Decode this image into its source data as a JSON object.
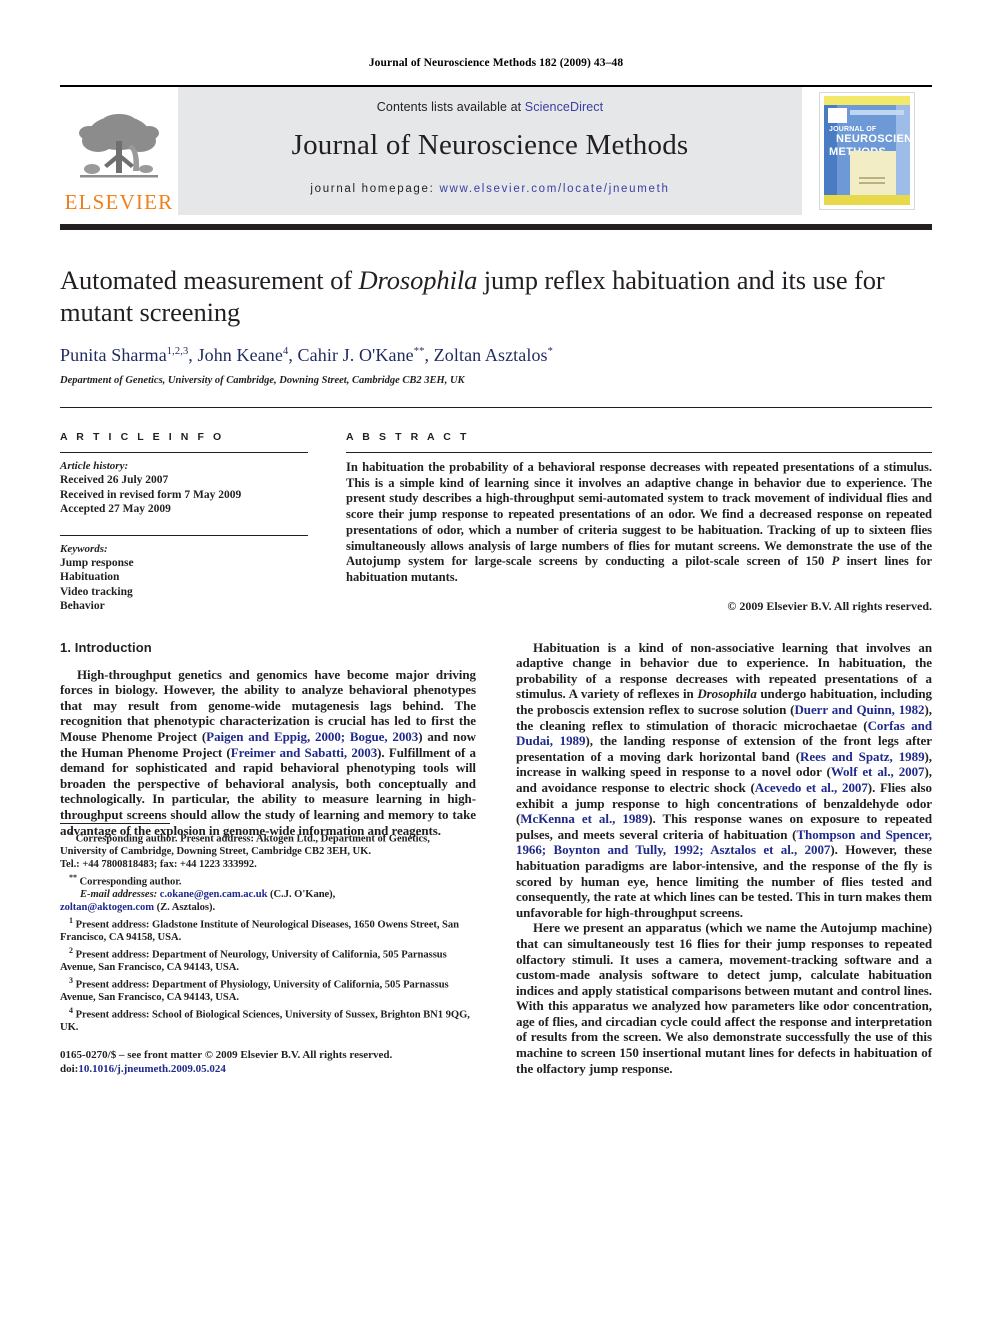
{
  "running_head": "Journal of Neuroscience Methods 182 (2009) 43–48",
  "masthead": {
    "publisher_logo_text": "ELSEVIER",
    "contents_prefix": "Contents lists available at ",
    "contents_link": "ScienceDirect",
    "journal_title": "Journal of Neuroscience Methods",
    "homepage_prefix": "journal homepage:",
    "homepage_url": "www.elsevier.com/locate/jneumeth",
    "cover": {
      "line1": "JOURNAL OF",
      "line2": "NEUROSCIENCE",
      "line3": "METHODS"
    }
  },
  "article": {
    "title_part1": "Automated measurement of ",
    "title_species": "Drosophila",
    "title_part2": " jump reflex habituation and its use for mutant screening",
    "authors": "Punita Sharma, John Keane, Cahir J. O'Kane, Zoltan Asztalos",
    "author_list": [
      {
        "name": "Punita Sharma",
        "marks": "1,2,3"
      },
      {
        "name": "John Keane",
        "marks": "4"
      },
      {
        "name": "Cahir J. O'Kane",
        "marks": "**"
      },
      {
        "name": "Zoltan Asztalos",
        "marks": "*"
      }
    ],
    "affiliation": "Department of Genetics, University of Cambridge, Downing Street, Cambridge CB2 3EH, UK"
  },
  "article_info": {
    "heading": "A R T I C L E   I N F O",
    "history_label": "Article history:",
    "history": [
      "Received 26 July 2007",
      "Received in revised form 7 May 2009",
      "Accepted 27 May 2009"
    ],
    "keywords_label": "Keywords:",
    "keywords": [
      "Jump response",
      "Habituation",
      "Video tracking",
      "Behavior"
    ]
  },
  "abstract": {
    "heading": "A B S T R A C T",
    "text_1": "In habituation the probability of a behavioral response decreases with repeated presentations of a stimulus. This is a simple kind of learning since it involves an adaptive change in behavior due to experience. The present study describes a high-throughput semi-automated system to track movement of individual flies and score their jump response to repeated presentations of an odor. We find a decreased response on repeated presentations of odor, which a number of criteria suggest to be habituation. Tracking of up to sixteen flies simultaneously allows analysis of large numbers of flies for mutant screens. We demonstrate the use of the Autojump system for large-scale screens by conducting a pilot-scale screen of 150 ",
    "text_italic": "P",
    "text_2": " insert lines for habituation mutants.",
    "copyright": "© 2009 Elsevier B.V. All rights reserved."
  },
  "introduction": {
    "section_number_title": "1.  Introduction",
    "p1_a": "High-throughput genetics and genomics have become major driving forces in biology. However, the ability to analyze behavioral phenotypes that may result from genome-wide mutagenesis lags behind. The recognition that phenotypic characterization is crucial has led to first the Mouse Phenome Project (",
    "p1_c1": "Paigen and Eppig, 2000; Bogue, 2003",
    "p1_b": ") and now the Human Phenome Project (",
    "p1_c2": "Freimer and Sabatti, 2003",
    "p1_d": "). Fulfillment of a demand for sophisticated and rapid behavioral phenotyping tools will broaden the perspective of behavioral analysis, both conceptually and technologically. In particular, the ability to measure learning in high-throughput screens should allow the study of learning and memory to take advantage of the explosion in genome-wide information and reagents.",
    "p2_a": "Habituation is a kind of non-associative learning that involves an adaptive change in behavior due to experience. In habituation, the probability of a response decreases with repeated presentations of a stimulus. A variety of reflexes in ",
    "p2_species": "Drosophila",
    "p2_b": " undergo habituation, including the proboscis extension reflex to sucrose solution (",
    "p2_c1": "Duerr and Quinn, 1982",
    "p2_c": "), the cleaning reflex to stimulation of thoracic microchaetae (",
    "p2_c2": "Corfas and Dudai, 1989",
    "p2_d": "), the landing response of extension of the front legs after presentation of a moving dark horizontal band (",
    "p2_c3": "Rees and Spatz, 1989",
    "p2_e": "), increase in walking speed in response to a novel odor (",
    "p2_c4": "Wolf et al., 2007",
    "p2_f": "), and avoidance response to electric shock (",
    "p2_c5": "Acevedo et al., 2007",
    "p2_g": "). Flies also exhibit a jump response to high concentrations of benzaldehyde odor (",
    "p2_c6": "McKenna et al., 1989",
    "p2_h": "). This response wanes on exposure to repeated pulses, and meets several criteria of habituation (",
    "p2_c7": "Thompson and Spencer, 1966; Boynton and Tully, 1992; Asztalos et al., 2007",
    "p2_i": "). However, these habituation paradigms are labor-intensive, and the response of the fly is scored by human eye, hence limiting the number of flies tested and consequently, the rate at which lines can be tested. This in turn makes them unfavorable for high-throughput screens.",
    "p3": "Here we present an apparatus (which we name the Autojump machine) that can simultaneously test 16 flies for their jump responses to repeated olfactory stimuli. It uses a camera, movement-tracking software and a custom-made analysis software to detect jump, calculate habituation indices and apply statistical comparisons between mutant and control lines. With this apparatus we analyzed how parameters like odor concentration, age of flies, and circadian cycle could affect the response and interpretation of results from the screen. We also demonstrate successfully the use of this machine to screen 150 insertional mutant lines for defects in habituation of the olfactory jump response."
  },
  "footnotes": {
    "corr1_mark": "*",
    "corr1": "Corresponding author. Present address: Aktogen Ltd., Department of Genetics, University of Cambridge, Downing Street, Cambridge CB2 3EH, UK.",
    "corr1_tel": "Tel.: +44 7800818483; fax: +44 1223 333992.",
    "corr2_mark": "**",
    "corr2": "Corresponding author.",
    "email_label": "E-mail addresses:",
    "email1": "c.okane@gen.cam.ac.uk",
    "email1_owner": "(C.J. O'Kane),",
    "email2": "zoltan@aktogen.com",
    "email2_owner": "(Z. Asztalos).",
    "note1_mark": "1",
    "note1": "Present address: Gladstone Institute of Neurological Diseases, 1650 Owens Street, San Francisco, CA 94158, USA.",
    "note2_mark": "2",
    "note2": "Present address: Department of Neurology, University of California, 505 Parnassus Avenue, San Francisco, CA 94143, USA.",
    "note3_mark": "3",
    "note3": "Present address: Department of Physiology, University of California, 505 Parnassus Avenue, San Francisco, CA 94143, USA.",
    "note4_mark": "4",
    "note4": "Present address: School of Biological Sciences, University of Sussex, Brighton BN1 9QG, UK."
  },
  "imprint": {
    "line1": "0165-0270/$ – see front matter © 2009 Elsevier B.V. All rights reserved.",
    "doi_prefix": "doi:",
    "doi": "10.1016/j.jneumeth.2009.05.024"
  },
  "colors": {
    "link_blue": "#1f2a8c",
    "author_blue": "#1f2a5e",
    "elsevier_orange": "#F07F1A",
    "masthead_gray": "#e6e7e9"
  }
}
